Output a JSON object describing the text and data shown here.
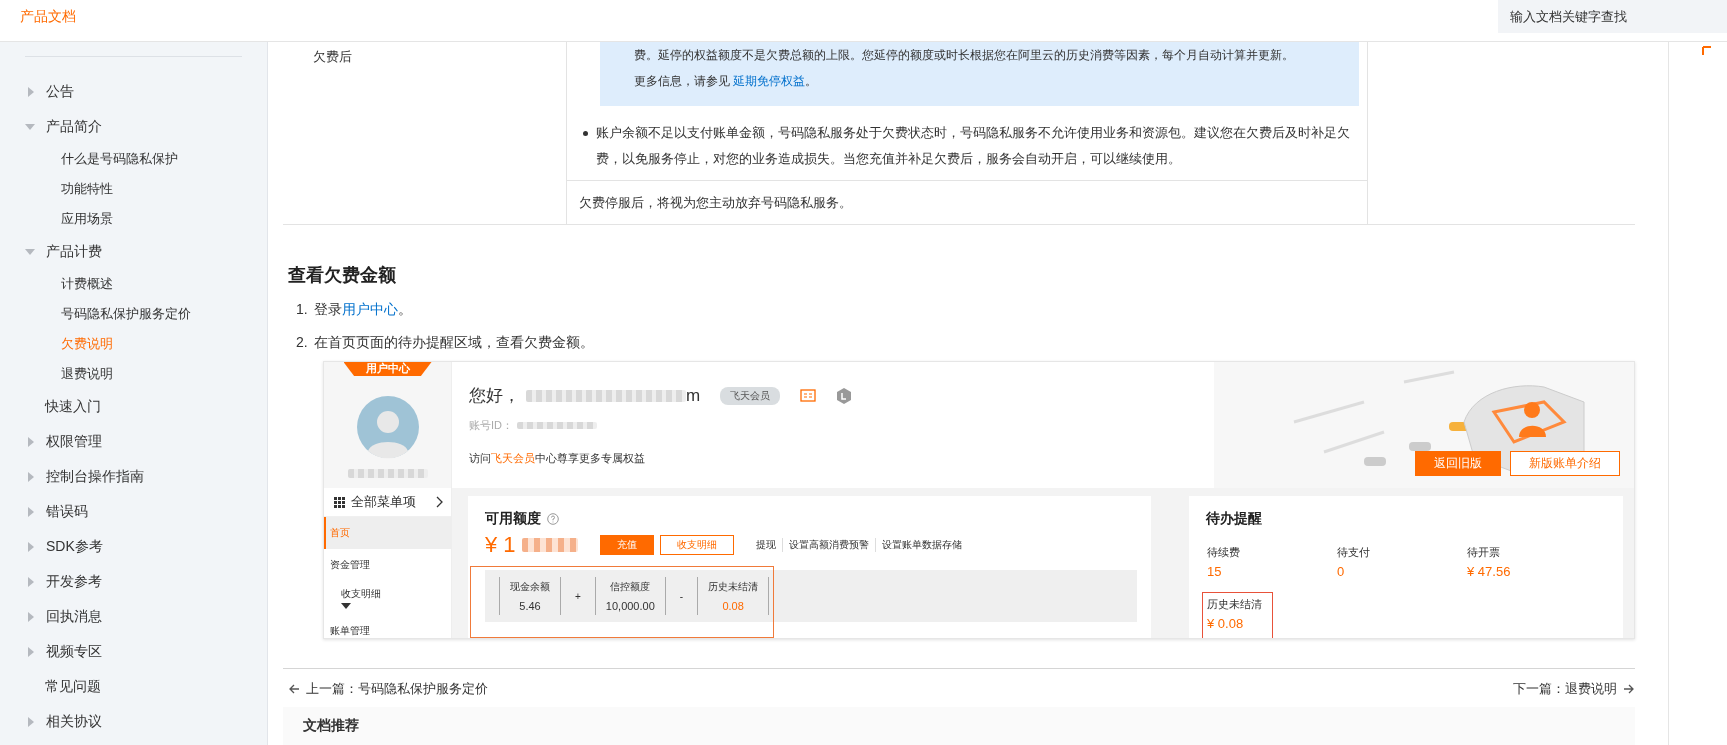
{
  "header": {
    "title": "产品文档",
    "search": {
      "placeholder": "输入文档关键字查找"
    }
  },
  "sidebar": {
    "items": [
      {
        "label": "公告",
        "kind": "folder",
        "expanded": false,
        "selected": false
      },
      {
        "label": "产品简介",
        "kind": "folder",
        "expanded": true,
        "selected": false,
        "children": [
          {
            "label": "什么是号码隐私保护",
            "selected": false
          },
          {
            "label": "功能特性",
            "selected": false
          },
          {
            "label": "应用场景",
            "selected": false
          }
        ]
      },
      {
        "label": "产品计费",
        "kind": "folder",
        "expanded": true,
        "selected": false,
        "children": [
          {
            "label": "计费概述",
            "selected": false
          },
          {
            "label": "号码隐私保护服务定价",
            "selected": false
          },
          {
            "label": "欠费说明",
            "selected": true
          },
          {
            "label": "退费说明",
            "selected": false
          }
        ]
      },
      {
        "label": "快速入门",
        "kind": "page",
        "selected": false
      },
      {
        "label": "权限管理",
        "kind": "folder",
        "expanded": false,
        "selected": false
      },
      {
        "label": "控制台操作指南",
        "kind": "folder",
        "expanded": false,
        "selected": false
      },
      {
        "label": "错误码",
        "kind": "folder",
        "expanded": false,
        "selected": false
      },
      {
        "label": "SDK参考",
        "kind": "folder",
        "expanded": false,
        "selected": false
      },
      {
        "label": "开发参考",
        "kind": "folder",
        "expanded": false,
        "selected": false
      },
      {
        "label": "回执消息",
        "kind": "folder",
        "expanded": false,
        "selected": false
      },
      {
        "label": "视频专区",
        "kind": "folder",
        "expanded": false,
        "selected": false
      },
      {
        "label": "常见问题",
        "kind": "page",
        "selected": false
      },
      {
        "label": "相关协议",
        "kind": "folder",
        "expanded": false,
        "selected": false
      }
    ]
  },
  "table": {
    "row_label": "欠费后",
    "note": {
      "text": "费。延停的权益额度不是欠费总额的上限。您延停的额度或时长根据您在阿里云的历史消费等因素，每个月自动计算并更新。",
      "more": "更多信息，请参见 ",
      "link": "延期免停权益",
      "end": "。"
    },
    "bullet": "账户余额不足以支付账单金额，号码隐私服务处于欠费状态时，号码隐私服务不允许使用业务和资源包。建议您在欠费后及时补足欠费，以免服务停止，对您的业务造成损失。当您充值并补足欠费后，服务会自动开启，可以继续使用。",
    "stop_text": "欠费停服后，将视为您主动放弃号码隐私服务。"
  },
  "section": {
    "heading": "查看欠费金额",
    "steps": [
      {
        "number": "1.",
        "text": "登录",
        "link": "用户中心",
        "end": "。"
      },
      {
        "number": "2.",
        "text": "在首页页面的待办提醒区域，查看欠费金额。"
      }
    ]
  },
  "screenshot": {
    "tab": "用户中心",
    "all_menu": "全部菜单项",
    "nav": [
      {
        "label": "首页",
        "selected": true,
        "kind": "item"
      },
      {
        "label": "资金管理",
        "selected": false,
        "kind": "item"
      },
      {
        "label": "收支明细",
        "selected": false,
        "kind": "subitem"
      },
      {
        "label": "账单管理",
        "selected": false,
        "kind": "item"
      }
    ],
    "greeting": "您好，",
    "email_tail": "m",
    "member_badge": "飞天会员",
    "account_label": "账号ID：",
    "promo": {
      "pre": "访问",
      "link": "飞天会员",
      "post": "中心尊享更多专属权益"
    },
    "buttons": [
      {
        "label": "返回旧版",
        "kind": "primary"
      },
      {
        "label": "新版账单介绍",
        "kind": "outline"
      }
    ],
    "balance": {
      "title": "可用额度",
      "amount": "¥ 1",
      "actions": [
        {
          "label": "充值",
          "kind": "primary"
        },
        {
          "label": "收支明细",
          "kind": "outline"
        }
      ],
      "links": [
        "提现",
        "设置高额消费预警",
        "设置账单数据存储"
      ],
      "highlighted": true,
      "breakdown": [
        {
          "kind": "value",
          "label": "现金余额",
          "value": "5.46",
          "accent": false
        },
        {
          "kind": "op",
          "text": "+"
        },
        {
          "kind": "value",
          "label": "信控额度",
          "value": "10,000.00",
          "accent": false
        },
        {
          "kind": "op",
          "text": "-"
        },
        {
          "kind": "value",
          "label": "历史未结清",
          "value": "0.08",
          "accent": true
        }
      ]
    },
    "todo": {
      "title": "待办提醒",
      "items": [
        {
          "label": "待续费",
          "value": "15",
          "highlighted": false
        },
        {
          "label": "待支付",
          "value": "0",
          "highlighted": false
        },
        {
          "label": "待开票",
          "value": "¥ 47.56",
          "highlighted": false
        },
        {
          "label": "历史未结清",
          "value": "¥ 0.08",
          "highlighted": true
        }
      ]
    }
  },
  "footer": {
    "prev": "上一篇：号码隐私保护服务定价",
    "next": "下一篇：退费说明",
    "recommend": "文档推荐"
  }
}
